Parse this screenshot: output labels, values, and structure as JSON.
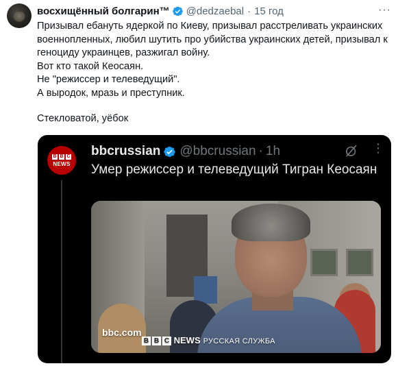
{
  "tweet": {
    "display_name": "восхищённый болгарин™",
    "handle": "@dedzaebal",
    "separator": "·",
    "time": "15 год",
    "lines": [
      "Призывал ебануть ядеркой по Киеву, призывал расстреливать украинских военнопленных, любил шутить про убийства украинских детей, призывал к геноциду украинцев, разжигал войну.",
      "Вот кто такой Кеосаян.",
      "Не \"режиссер и телеведущий\".",
      "А выродок, мразь и преступник.",
      "Стекловатой, уёбок"
    ],
    "more_label": "···"
  },
  "quote": {
    "display_name": "bbcrussian",
    "handle": "@bbcrussian",
    "separator": "·",
    "time": "1h",
    "text": "Умер режиссер и телеведущий Тигран Кеосаян",
    "more_label": "⋮",
    "avatar_letters": [
      "B",
      "B",
      "C"
    ],
    "avatar_word": "NEWS",
    "media": {
      "watermark_site": "bbc.com",
      "watermark_letters": [
        "B",
        "B",
        "C"
      ],
      "watermark_news": "NEWS",
      "watermark_service": "РУССКАЯ СЛУЖБА"
    }
  },
  "colors": {
    "verified": "#1d9bf0",
    "text_primary": "#0f1419",
    "text_secondary": "#536471",
    "bbc_red": "#b80000",
    "quote_bg": "#000000"
  },
  "icons": [
    "avatar",
    "verified-badge-icon",
    "more-icon",
    "grok-icon"
  ]
}
